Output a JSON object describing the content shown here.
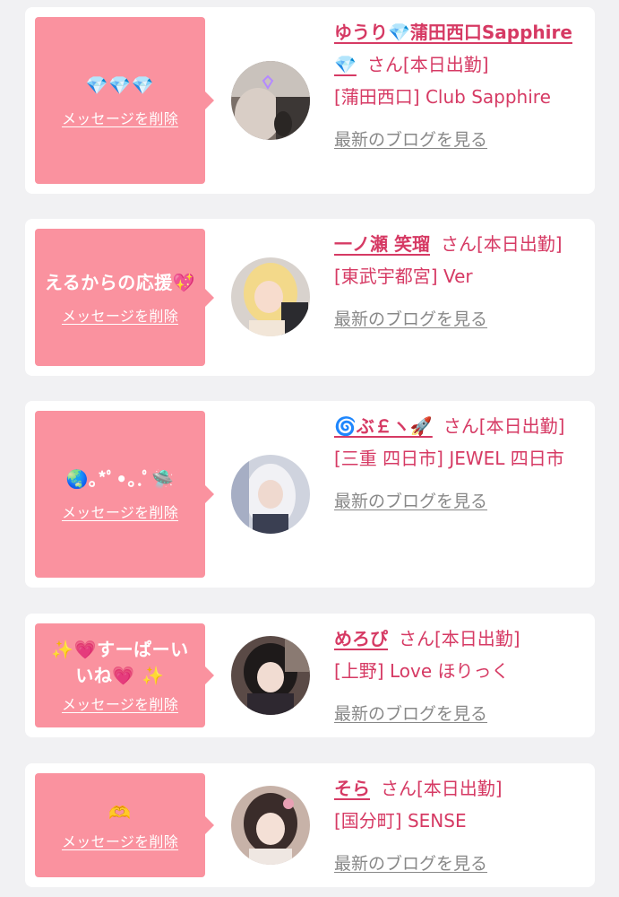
{
  "colors": {
    "page_bg": "#f1f1f3",
    "bubble_bg": "#fa929f",
    "accent": "#d63a64",
    "link_gray": "#888888"
  },
  "icons": [
    "diamond-icon",
    "heart-icon",
    "sparkles-icon",
    "globe-icon",
    "rocket-icon",
    "ufo-icon",
    "heart-hands-icon"
  ],
  "items": [
    {
      "message": "💎💎💎",
      "delete_label": "メッセージを削除",
      "name": "ゆうり💎蒲田西口Sapphire💎",
      "suffix": "さん[本日出勤]",
      "shop": "[蒲田西口] Club Sapphire",
      "blog_label": "最新のブログを見る"
    },
    {
      "message": "えるからの応援💖",
      "delete_label": "メッセージを削除",
      "name": "一ノ瀬 笑瑠",
      "suffix": "さん[本日出勤]",
      "shop": "[東武宇都宮] Ver",
      "blog_label": "最新のブログを見る"
    },
    {
      "message": "🌏｡*ﾟ•｡.ﾟ🛸",
      "delete_label": "メッセージを削除",
      "name": "🌀ぶ￡ヽ🚀",
      "suffix": "さん[本日出勤]",
      "shop": "[三重 四日市] JEWEL 四日市",
      "blog_label": "最新のブログを見る"
    },
    {
      "message": "✨💗すーぱーいいね💗 ✨",
      "delete_label": "メッセージを削除",
      "name": "めろぴ",
      "suffix": "さん[本日出勤]",
      "shop": "[上野] Love ほりっく",
      "blog_label": "最新のブログを見る"
    },
    {
      "message": "🫶",
      "delete_label": "メッセージを削除",
      "name": "そら",
      "suffix": "さん[本日出勤]",
      "shop": "[国分町] SENSE",
      "blog_label": "最新のブログを見る"
    }
  ]
}
